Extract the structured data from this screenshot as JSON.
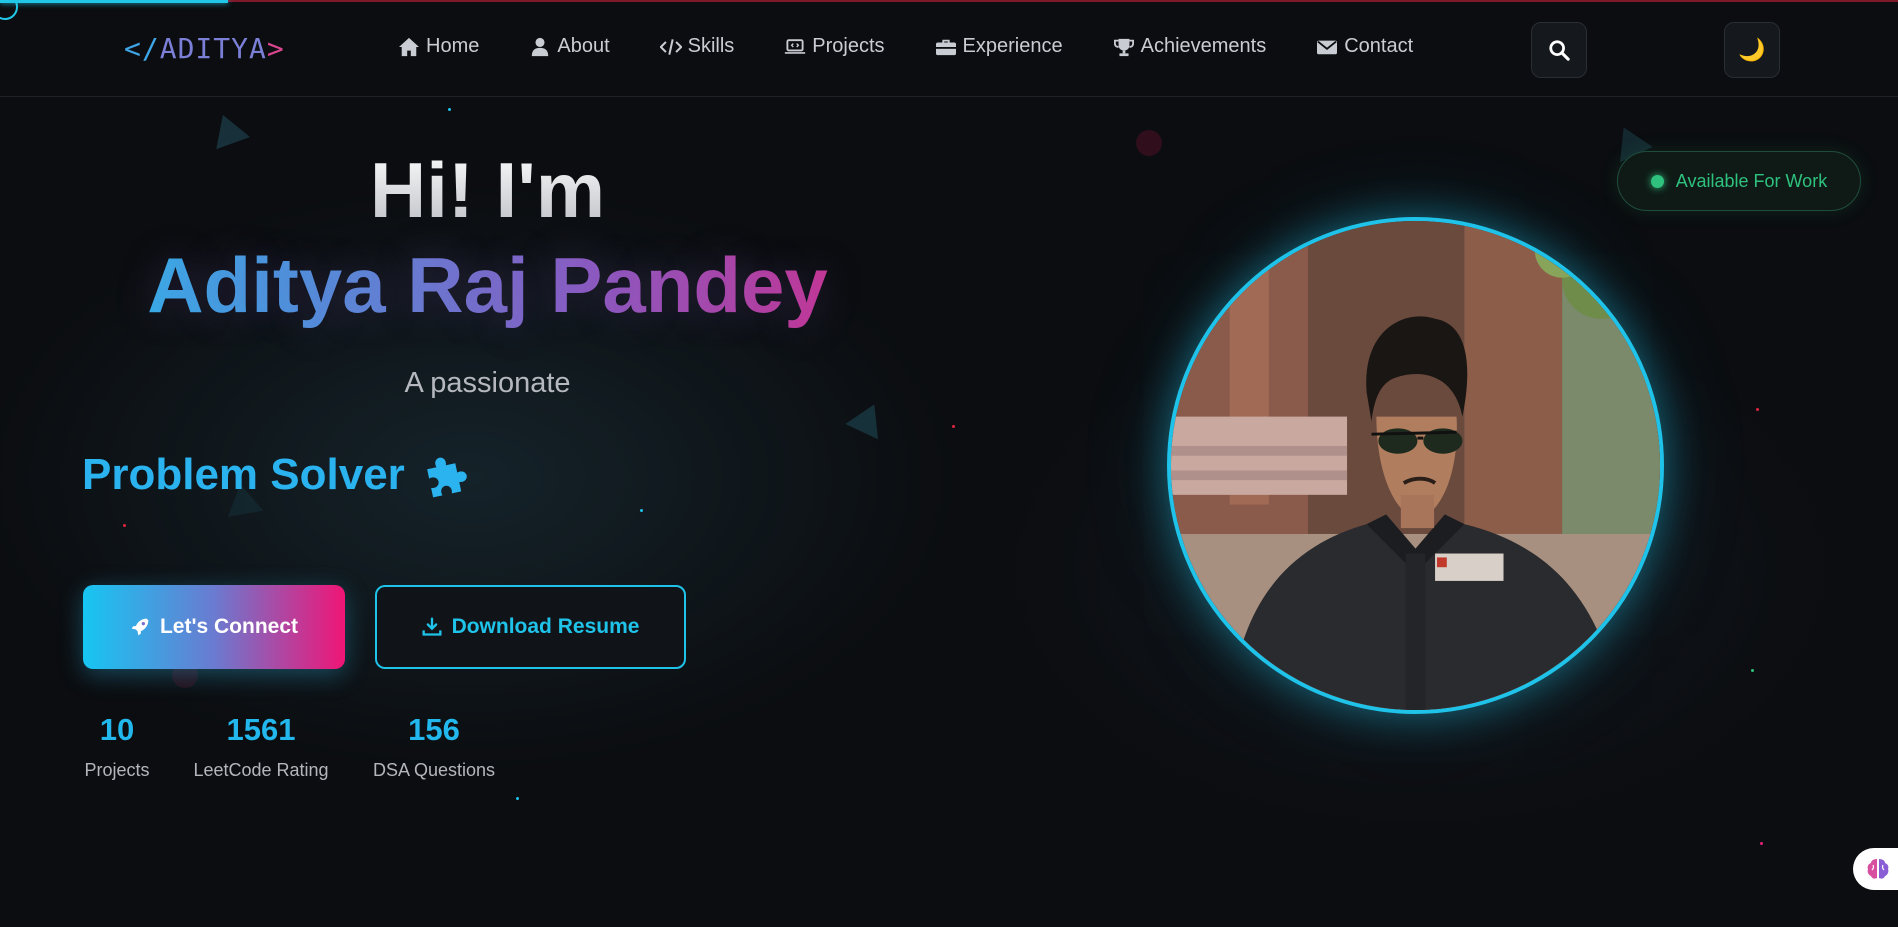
{
  "header": {
    "logo": {
      "open": "</",
      "name": "ADITYA",
      "close": ">"
    },
    "nav": [
      {
        "label": "Home",
        "icon": "home-icon"
      },
      {
        "label": "About",
        "icon": "user-icon"
      },
      {
        "label": "Skills",
        "icon": "code-icon"
      },
      {
        "label": "Projects",
        "icon": "laptop-code-icon"
      },
      {
        "label": "Experience",
        "icon": "briefcase-icon"
      },
      {
        "label": "Achievements",
        "icon": "trophy-icon"
      },
      {
        "label": "Contact",
        "icon": "envelope-icon"
      }
    ],
    "search_icon": "search-icon",
    "theme_toggle": "🌙"
  },
  "hero": {
    "greeting": "Hi! I'm",
    "name": "Aditya Raj Pandey",
    "tagline": "A passionate",
    "role": "Problem Solver",
    "role_icon": "puzzle-piece-icon",
    "buttons": {
      "connect": "Let's Connect",
      "resume": "Download Resume"
    },
    "stats": [
      {
        "value": "10",
        "label": "Projects"
      },
      {
        "value": "1561",
        "label": "LeetCode Rating"
      },
      {
        "value": "156",
        "label": "DSA Questions"
      }
    ]
  },
  "status_badge": "Available For Work",
  "scroll_progress": 0.12,
  "colors": {
    "accent_cyan": "#1fc2e8",
    "accent_pink": "#e81f7a",
    "available_green": "#2ec27e",
    "background": "#0b0d10"
  }
}
